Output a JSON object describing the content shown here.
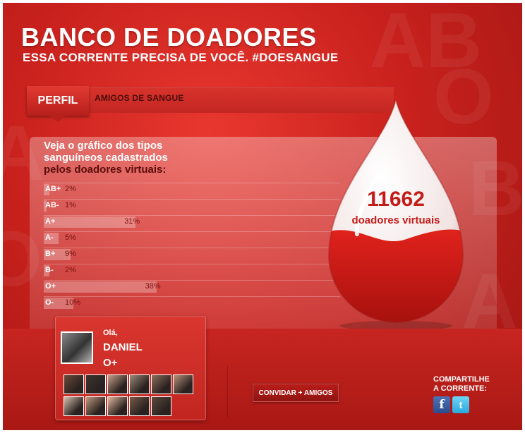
{
  "header": {
    "title": "BANCO DE DOADORES",
    "subtitle": "ESSA CORRENTE PRECISA DE VOCÊ. #DOESANGUE"
  },
  "tabs": [
    {
      "label": "PERFIL",
      "active": true
    },
    {
      "label": "AMIGOS DE SANGUE",
      "active": false
    }
  ],
  "chart_intro": {
    "line1": "Veja o gráfico dos tipos",
    "line2": "sanguíneos cadastrados",
    "line3": "pelos doadores virtuais:"
  },
  "chart_data": {
    "type": "bar",
    "orientation": "horizontal",
    "categories": [
      "AB+",
      "AB-",
      "A+",
      "A-",
      "B+",
      "B-",
      "O+",
      "O-"
    ],
    "values": [
      2,
      1,
      31,
      5,
      9,
      2,
      38,
      10
    ],
    "value_labels": [
      "2%",
      "1%",
      "31%",
      "5%",
      "9%",
      "2%",
      "38%",
      "10%"
    ],
    "xlim": [
      0,
      100
    ]
  },
  "counter": {
    "value": "11662",
    "label": "doadores virtuais",
    "fill_fraction": 0.4
  },
  "profile": {
    "greeting": "Olá,",
    "name": "DANIEL",
    "blood_type": "O+"
  },
  "friends": {
    "colors": [
      "#6b4a3a",
      "#3d3530",
      "#c7a08a",
      "#9a8a78",
      "#8d6f5c",
      "#b9927a",
      "#d6c0b0",
      "#c19a80",
      "#e0b89c",
      "#7a5a48",
      "#5b4a40"
    ]
  },
  "actions": {
    "invite_label": "CONVIDAR + AMIGOS"
  },
  "share": {
    "line1": "COMPARTILHE",
    "line2": "A CORRENTE:",
    "facebook_glyph": "f",
    "twitter_glyph": "t"
  },
  "colors": {
    "brand_red": "#c9211d",
    "dark_red": "#9e1512",
    "counter_red": "#c41d19"
  }
}
